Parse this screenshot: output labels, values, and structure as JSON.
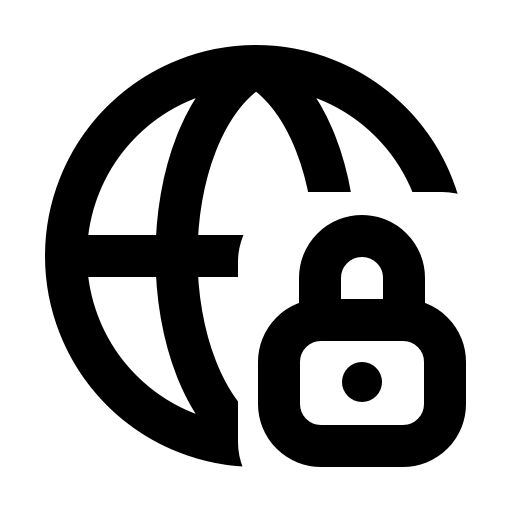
{
  "icon": {
    "name": "globe-lock-icon",
    "parts": [
      "globe-icon",
      "padlock-icon"
    ],
    "colors": {
      "foreground": "#000000",
      "background": "#ffffff"
    }
  }
}
